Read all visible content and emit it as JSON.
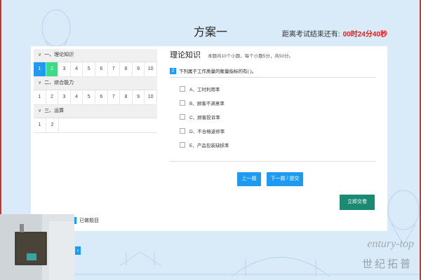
{
  "header": {
    "exam_title": "方案一",
    "timer_label": "距离考试结束还有:",
    "timer_value": "00时24分40秒"
  },
  "sidebar": {
    "sections": [
      {
        "title": "一、理论知识",
        "numbers": [
          "1",
          "2",
          "3",
          "4",
          "5",
          "6",
          "7",
          "8",
          "9",
          "10"
        ],
        "current": "1",
        "done": [
          "2"
        ]
      },
      {
        "title": "二、综合能力",
        "numbers": [
          "1",
          "2",
          "3",
          "4",
          "5",
          "6",
          "7",
          "8",
          "9",
          "10"
        ],
        "current": "",
        "done": []
      },
      {
        "title": "三、运算",
        "numbers": [
          "1",
          "2"
        ],
        "current": "",
        "done": []
      }
    ]
  },
  "main": {
    "section_title": "理论知识",
    "section_desc": "本题共10个小题，每个小题5分，共50分。",
    "question_number": "2",
    "question_text": "下列属于工作质量的衡量指标的有( )。",
    "options": [
      "A、工时利用率",
      "B、顾客不满意率",
      "C、顾客投诉率",
      "D、不合格返修率",
      "E、产品包装缺损率"
    ],
    "prev_label": "上一题",
    "next_label": "下一题 / 提交",
    "submit_label": "立即交卷"
  },
  "legend": {
    "answered_label": "已做题目"
  },
  "camera": {
    "toggle_icon": "chevron-left-icon"
  },
  "watermark": {
    "en": "entury-top",
    "zh": "世纪拓普"
  },
  "colors": {
    "accent": "#1e9bf0",
    "done": "#3ddc84",
    "submit": "#1b8a72",
    "timer": "#e02020"
  }
}
